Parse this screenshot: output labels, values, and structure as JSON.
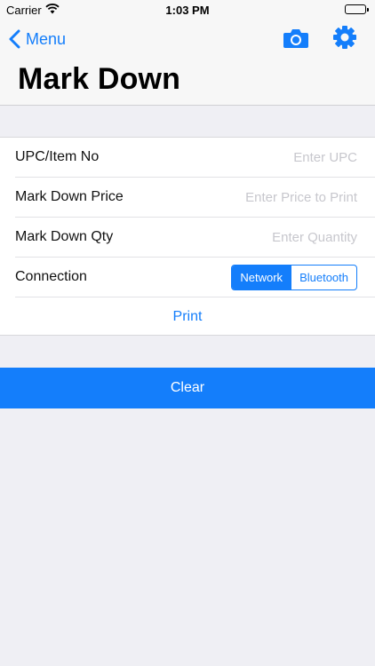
{
  "status_bar": {
    "carrier": "Carrier",
    "time": "1:03 PM",
    "wifi_icon": "wifi-icon",
    "battery_icon": "battery-icon",
    "battery_level": 1.0
  },
  "nav": {
    "back_label": "Menu",
    "title": "Mark Down",
    "camera_icon": "camera-icon",
    "settings_icon": "gear-icon"
  },
  "form": {
    "upc": {
      "label": "UPC/Item No",
      "value": "",
      "placeholder": "Enter UPC"
    },
    "price": {
      "label": "Mark Down Price",
      "value": "",
      "placeholder": "Enter Price to Print"
    },
    "qty": {
      "label": "Mark Down Qty",
      "value": "",
      "placeholder": "Enter Quantity"
    },
    "connection": {
      "label": "Connection",
      "options": [
        "Network",
        "Bluetooth"
      ],
      "selected": "Network"
    },
    "print_label": "Print"
  },
  "clear_label": "Clear",
  "colors": {
    "accent": "#147efb",
    "background": "#efeff4",
    "nav_background": "#f7f7f7",
    "placeholder": "#c7c7cd"
  }
}
